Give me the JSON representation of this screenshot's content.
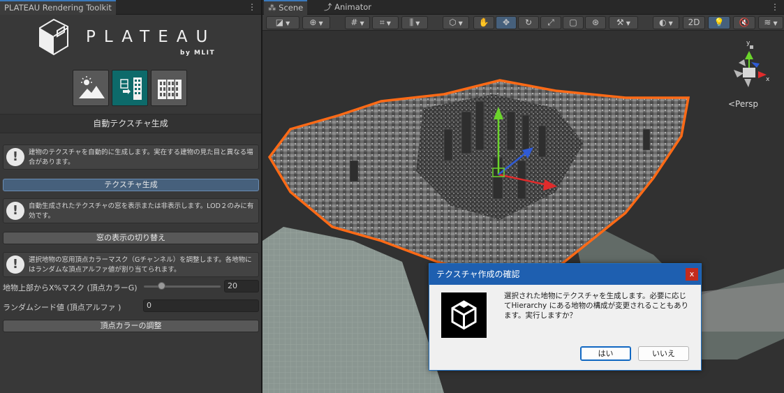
{
  "left_panel": {
    "tab_title": "PLATEAU Rendering Toolkit",
    "logo": {
      "word": "PLATEAU",
      "by": "by MLIT"
    },
    "mode_buttons": [
      {
        "icon": "landscape-icon",
        "selected": false
      },
      {
        "icon": "building-texture-icon",
        "selected": true
      },
      {
        "icon": "building-windows-icon",
        "selected": false
      }
    ],
    "section_title": "自動テクスチャ生成",
    "help_1": "建物のテクスチャを自動的に生成します。実在する建物の見た目と異なる場合があります。",
    "button_generate": "テクスチャ生成",
    "help_2": "自動生成されたテクスチャの窓を表示または非表示します。LOD２のみに有効です。",
    "button_toggle_windows": "窓の表示の切り替え",
    "help_3": "選択地物の窓用頂点カラーマスク（Gチャンネル）を調整します。各地物にはランダムな頂点アルファ値が割り当てられます。",
    "mask_label": "地物上部からX%マスク (頂点カラーG)",
    "mask_value": "20",
    "seed_label": "ランダムシード値 (頂点アルファ )",
    "seed_value": "0",
    "button_adjust": "頂点カラーの調整"
  },
  "scene": {
    "tabs": [
      "Scene",
      "Animator"
    ],
    "toolbar": {
      "toggle_2d": "2D"
    },
    "persp_label": "<Persp",
    "axis_labels": {
      "y": "y",
      "x": "x"
    }
  },
  "dialog": {
    "title": "テクスチャ作成の確認",
    "close": "x",
    "message": "選択された地物にテクスチャを生成します。必要に応じてHierarchy にある地物の構成が変更されることもあります。実行しますか？",
    "yes": "はい",
    "no": "いいえ"
  },
  "colors": {
    "accent": "#3a79bb",
    "selection_outline": "#ff6a16",
    "dialog_title_bar": "#1e5fb0",
    "selected_mode": "#0d6a6a"
  }
}
